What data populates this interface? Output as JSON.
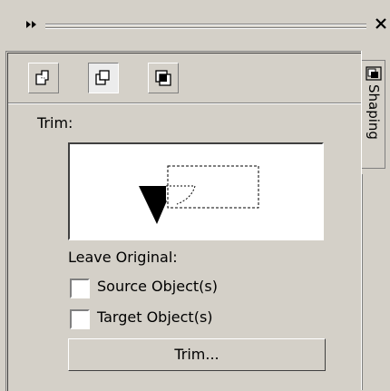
{
  "title_bar": {
    "grip_icon": "double-chevron-right",
    "close_icon": "close-x"
  },
  "toolbar": {
    "buttons": [
      {
        "name": "weld-mode",
        "icon": "weld-shapes-icon",
        "pressed": false
      },
      {
        "name": "trim-mode",
        "icon": "trim-shapes-icon",
        "pressed": true
      },
      {
        "name": "intersect-mode",
        "icon": "intersect-shapes-icon",
        "pressed": false
      }
    ]
  },
  "section": {
    "title": "Trim:"
  },
  "leave_original": {
    "label": "Leave Original:",
    "options": [
      {
        "label": "Source Object(s)",
        "checked": false
      },
      {
        "label": "Target Object(s)",
        "checked": false
      }
    ]
  },
  "action": {
    "label": "Trim..."
  },
  "side_tab": {
    "label": "Shaping",
    "icon": "shaping-icon"
  }
}
